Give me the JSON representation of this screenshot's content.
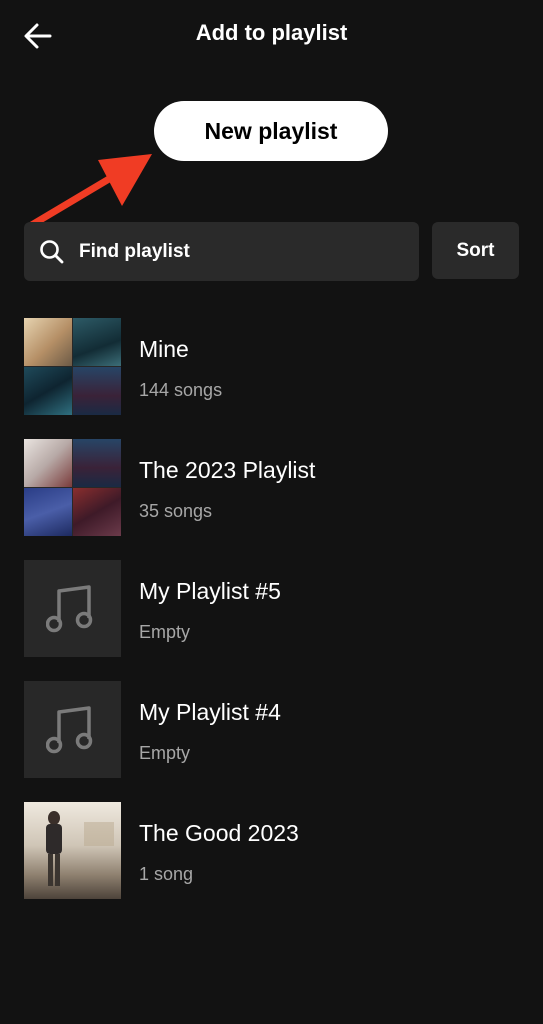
{
  "header": {
    "title": "Add to playlist",
    "back_icon": "arrow-left-icon"
  },
  "new_playlist": {
    "label": "New playlist"
  },
  "annotation": {
    "color": "#f03c24"
  },
  "search": {
    "label": "Find playlist",
    "icon": "search-icon"
  },
  "sort": {
    "label": "Sort"
  },
  "playlists": [
    {
      "name": "Mine",
      "meta": "144 songs",
      "artwork": "collage"
    },
    {
      "name": "The 2023 Playlist",
      "meta": "35 songs",
      "artwork": "collage"
    },
    {
      "name": "My Playlist #5",
      "meta": "Empty",
      "artwork": "music-note-icon"
    },
    {
      "name": "My Playlist #4",
      "meta": "Empty",
      "artwork": "music-note-icon"
    },
    {
      "name": "The Good 2023",
      "meta": "1 song",
      "artwork": "album-cover"
    }
  ],
  "colors": {
    "background": "#121212",
    "surface": "#2a2a2a",
    "secondary_text": "#a7a7a7"
  }
}
